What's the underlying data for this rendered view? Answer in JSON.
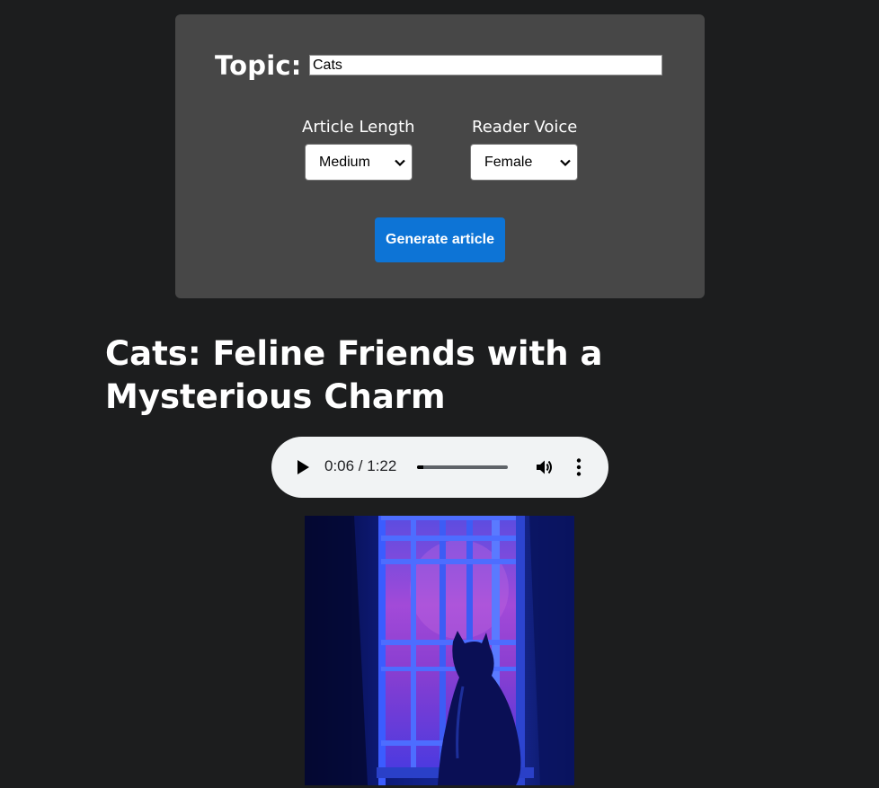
{
  "form": {
    "topic_label": "Topic:",
    "topic_value": "Cats",
    "length_label": "Article Length",
    "length_selected": "Medium",
    "voice_label": "Reader Voice",
    "voice_selected": "Female",
    "generate_label": "Generate article"
  },
  "article": {
    "title": "Cats: Feline Friends with a Mysterious Charm",
    "audio": {
      "time": "0:06 / 1:22",
      "progress": 0.073
    },
    "image_icon": "cat-at-window-image"
  },
  "colors": {
    "page_background": "#1c1d1e",
    "panel_background": "#474747",
    "button_accent": "#0d74d6",
    "audio_background": "#f1f3f4"
  },
  "icons": [
    "play-icon",
    "volume-icon",
    "more-options-icon",
    "chevron-down-icon"
  ]
}
